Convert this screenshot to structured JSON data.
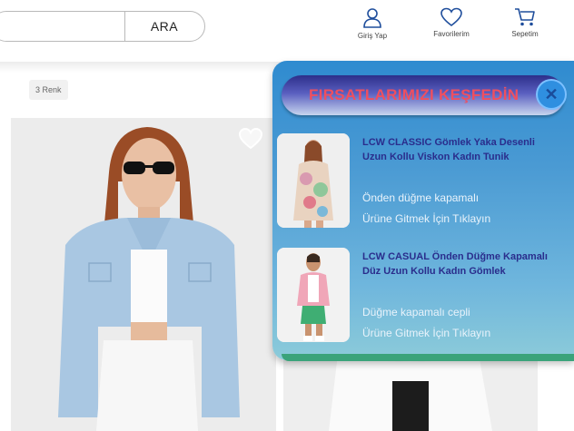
{
  "header": {
    "search_placeholder": "",
    "search_button": "ARA",
    "login_label": "Giriş Yap",
    "favorites_label": "Favorilerim",
    "cart_label": "Sepetim"
  },
  "listing": {
    "color_count": "3 Renk"
  },
  "popup": {
    "title": "FIRSATLARIMIZI KEŞFEDİN",
    "offers": [
      {
        "title": "LCW CLASSIC Gömlek Yaka Desenli Uzun Kollu Viskon Kadın Tunik",
        "description": "Önden düğme kapamalı",
        "cta": "Ürüne Gitmek İçin Tıklayın"
      },
      {
        "title": "LCW CASUAL Önden Düğme Kapamalı Düz Uzun Kollu Kadın Gömlek",
        "description": "Düğme kapamalı cepli",
        "cta": "Ürüne Gitmek İçin Tıklayın"
      }
    ]
  },
  "colors": {
    "popup_top": "#2f8bd0",
    "title_text": "#ef4f5f",
    "offer_title": "#2a2d8c",
    "icon_blue": "#1f4e9c"
  }
}
